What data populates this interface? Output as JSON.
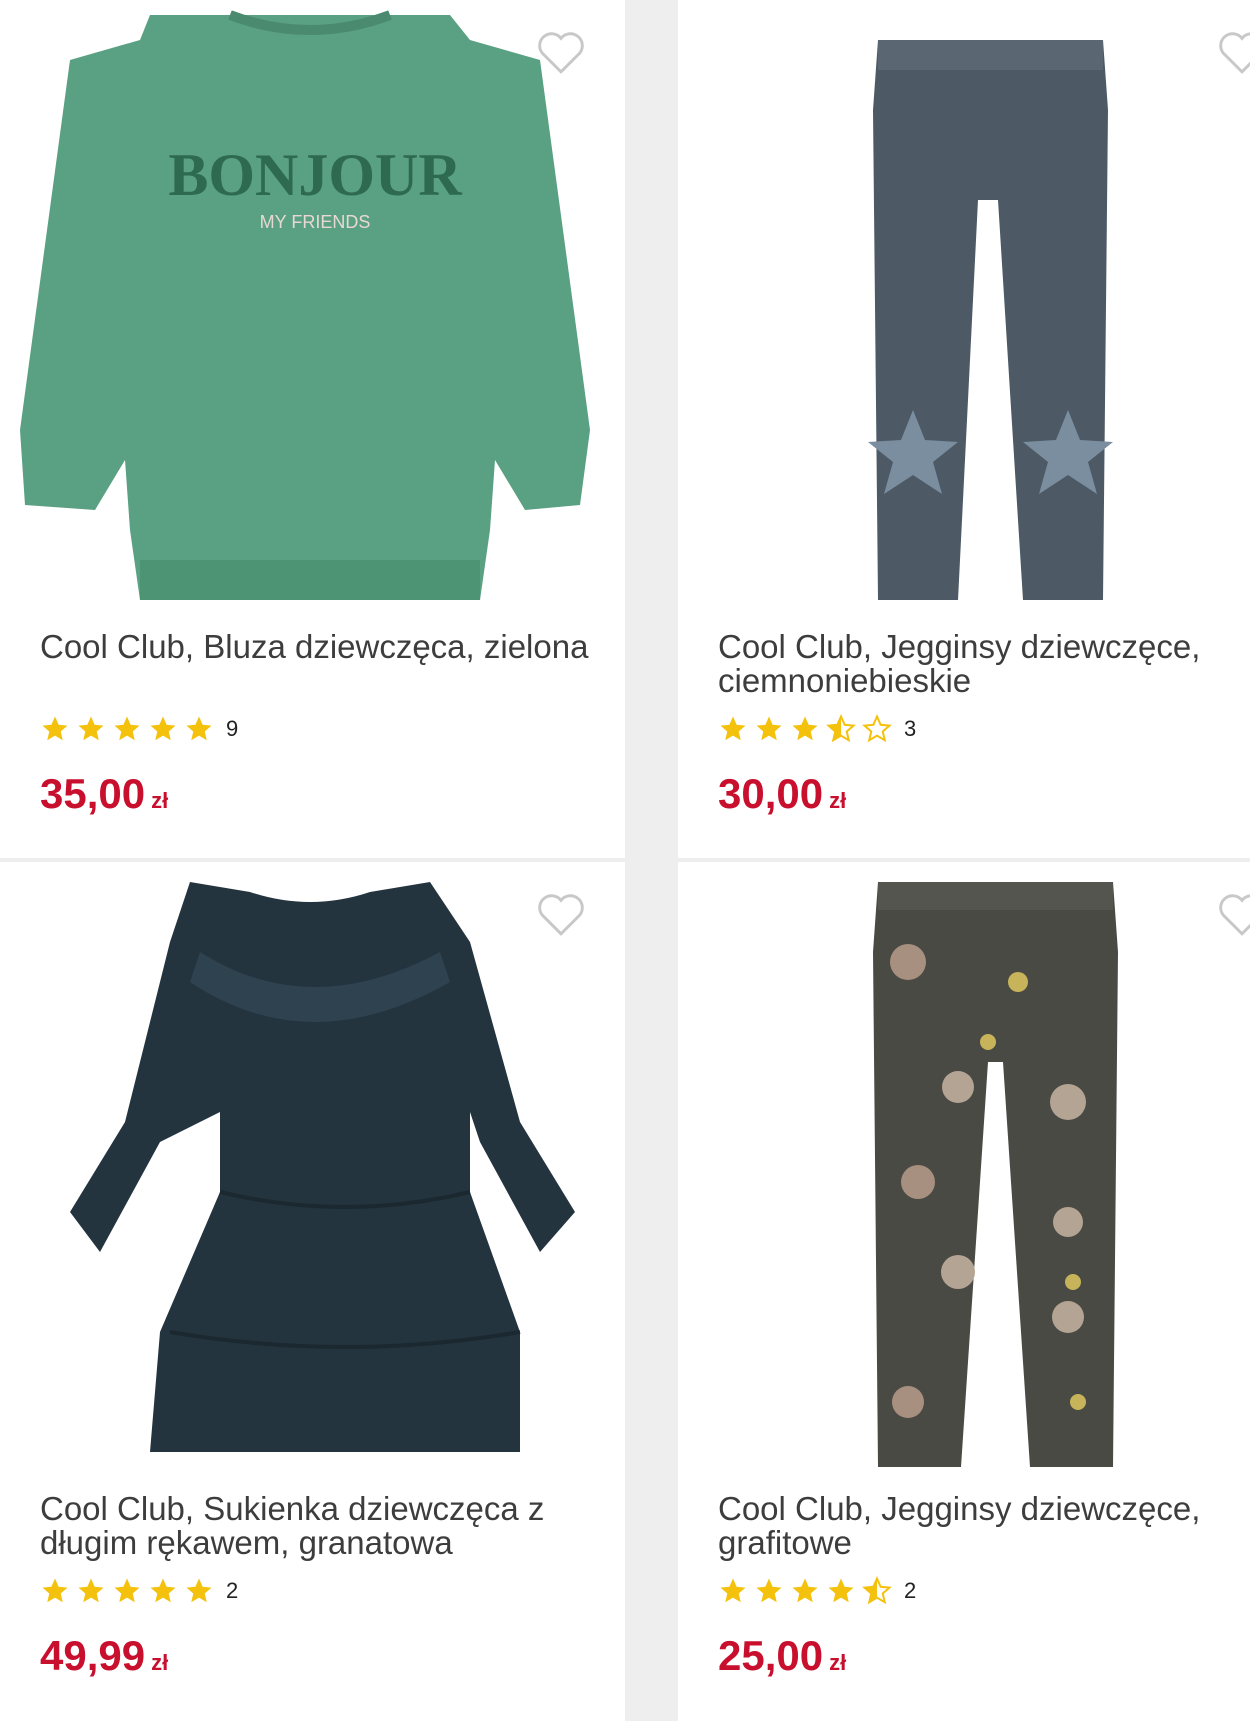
{
  "products": [
    {
      "title": "Cool Club, Bluza dziewczęca, zielona",
      "rating": 5,
      "review_count": "9",
      "price": "35,00",
      "currency": "zł",
      "image": "green-sweatshirt-dress",
      "image_text": [
        "BONJOUR",
        "MY FRIENDS"
      ]
    },
    {
      "title": "Cool Club, Jegginsy dziewczęce, ciemnoniebieskie",
      "rating": 3.5,
      "review_count": "3",
      "price": "30,00",
      "currency": "zł",
      "image": "grey-leggings-with-stars"
    },
    {
      "title": "Cool Club, Sukienka dziewczęca z długim rękawem, granatowa",
      "rating": 5,
      "review_count": "2",
      "price": "49,99",
      "currency": "zł",
      "image": "navy-ruffle-dress"
    },
    {
      "title": "Cool Club, Jegginsy dziewczęce, grafitowe",
      "rating": 4.5,
      "review_count": "2",
      "price": "25,00",
      "currency": "zł",
      "image": "graphite-leggings-bear-print"
    }
  ],
  "colors": {
    "price": "#c8102e",
    "star": "#f4c20d",
    "star_empty_stroke": "#f4c20d",
    "heart_stroke": "#c8c8c8"
  },
  "icons": {
    "favorite": "heart-outline-icon",
    "rating": "star-icon"
  }
}
